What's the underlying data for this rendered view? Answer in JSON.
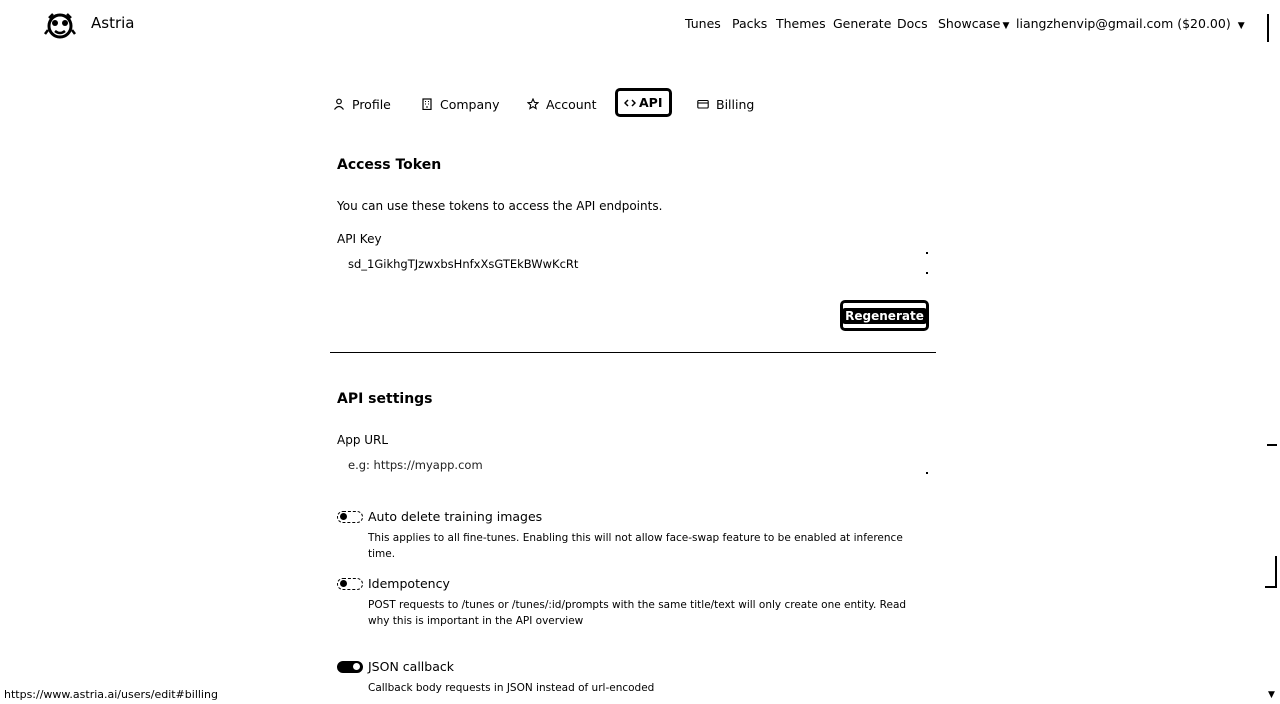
{
  "header": {
    "brand": "Astria",
    "nav": [
      "Tunes",
      "Packs",
      "Themes",
      "Generate",
      "Docs",
      "Showcase"
    ],
    "account": "liangzhenvip@gmail.com ($20.00)"
  },
  "tabs": [
    {
      "label": "Profile",
      "icon": "user-icon"
    },
    {
      "label": "Company",
      "icon": "building-icon"
    },
    {
      "label": "Account",
      "icon": "star-icon"
    },
    {
      "label": "API",
      "icon": "code-icon",
      "active": true
    },
    {
      "label": "Billing",
      "icon": "card-icon"
    }
  ],
  "access_token": {
    "title": "Access Token",
    "description": "You can use these tokens to access the API endpoints.",
    "key_label": "API Key",
    "key_value": "sd_1GikhgTJzwxbsHnfxXsGTEkBWwKcRt",
    "regenerate_label": "Regenerate"
  },
  "api_settings": {
    "title": "API settings",
    "app_url_label": "App URL",
    "app_url_placeholder": "e.g: https://myapp.com",
    "settings": [
      {
        "title": "Auto delete training images",
        "description": "This applies to all fine-tunes. Enabling this will not allow face-swap feature to be enabled at inference time.",
        "enabled": false
      },
      {
        "title": "Idempotency",
        "description": "POST requests to /tunes or /tunes/:id/prompts with the same title/text will only create one entity. Read why this is important in the API overview",
        "enabled": false
      },
      {
        "title": "JSON callback",
        "description": "Callback body requests in JSON instead of url-encoded",
        "enabled": true
      }
    ]
  },
  "status_url": "https://www.astria.ai/users/edit#billing"
}
